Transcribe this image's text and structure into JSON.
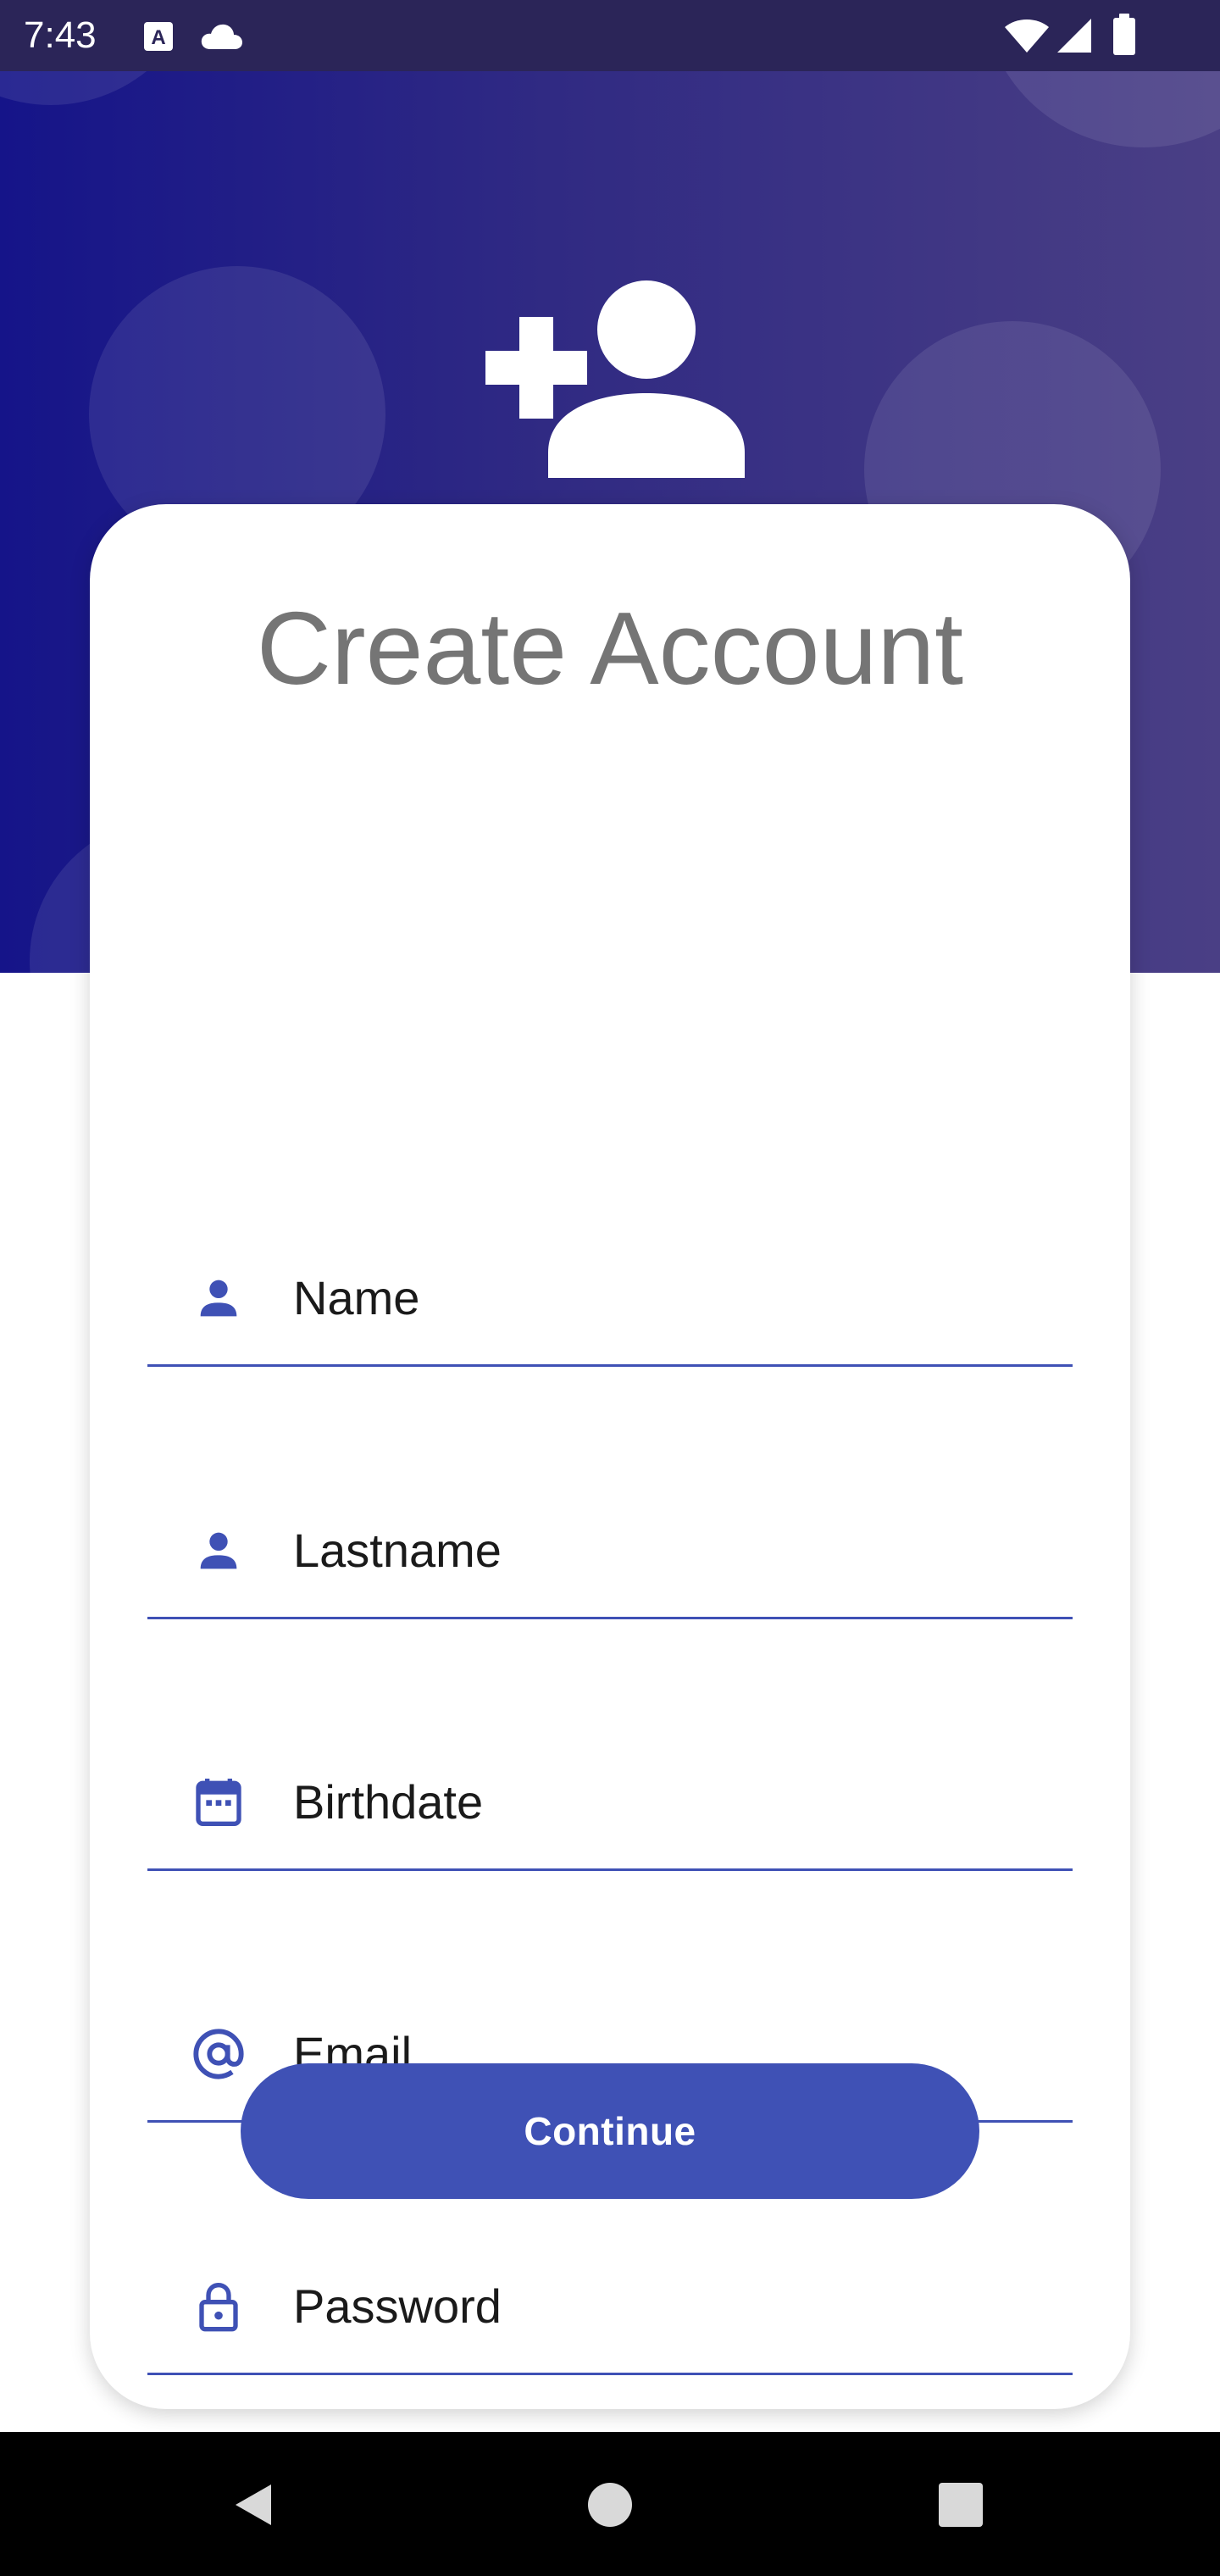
{
  "status_bar": {
    "time": "7:43",
    "left_icons": [
      "keyboard-a-icon",
      "cloud-icon"
    ],
    "right_icons": [
      "wifi-icon",
      "signal-icon",
      "battery-icon"
    ]
  },
  "header": {
    "icon": "person-add-icon",
    "accent_colors": [
      "#151489",
      "#4a3f85"
    ]
  },
  "form": {
    "title": "Create Account",
    "fields": [
      {
        "icon": "person-icon",
        "placeholder": "Name"
      },
      {
        "icon": "person-icon",
        "placeholder": "Lastname"
      },
      {
        "icon": "calendar-icon",
        "placeholder": "Birthdate"
      },
      {
        "icon": "at-sign-icon",
        "placeholder": "Email"
      },
      {
        "icon": "lock-icon",
        "placeholder": "Password"
      }
    ],
    "continue_label": "Continue",
    "accent_color": "#3f51b5"
  },
  "nav_bar": {
    "buttons": [
      "back-icon",
      "home-icon",
      "recents-icon"
    ]
  }
}
